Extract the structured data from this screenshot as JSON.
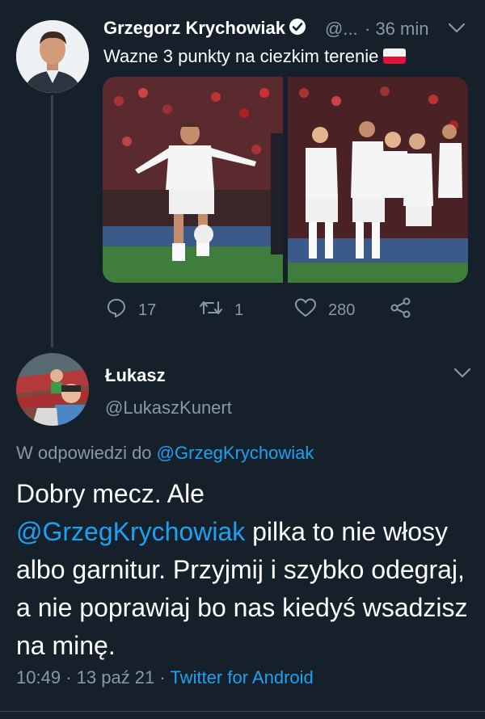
{
  "tweet1": {
    "author_name": "Grzegorz Krychowiak",
    "handle": "@...",
    "time": "· 36 min",
    "text": "Wazne 3 punkty na ciezkim terenie",
    "flag_icon": "poland-flag-icon",
    "stats": {
      "replies": "17",
      "retweets": "1",
      "likes": "280"
    }
  },
  "tweet2": {
    "author_name": "Łukasz",
    "handle": "@LukaszKunert",
    "replying_prefix": "W odpowiedzi do",
    "replying_handle": "@GrzegKrychowiak",
    "body_start": "Dobry mecz. Ale",
    "body_mention": "@GrzegKrychowiak",
    "body_rest": "pilka to nie włosy albo garnitur. Przyjmij i szybko odegraj, a nie poprawiaj bo nas kiedyś wsadzisz na minę.",
    "time": "10:49",
    "date": "13 paź 21",
    "client": "Twitter for Android"
  },
  "colors": {
    "background": "#15202b",
    "secondary_text": "#8899a6",
    "link": "#1da1f2",
    "divider": "#38444d"
  }
}
